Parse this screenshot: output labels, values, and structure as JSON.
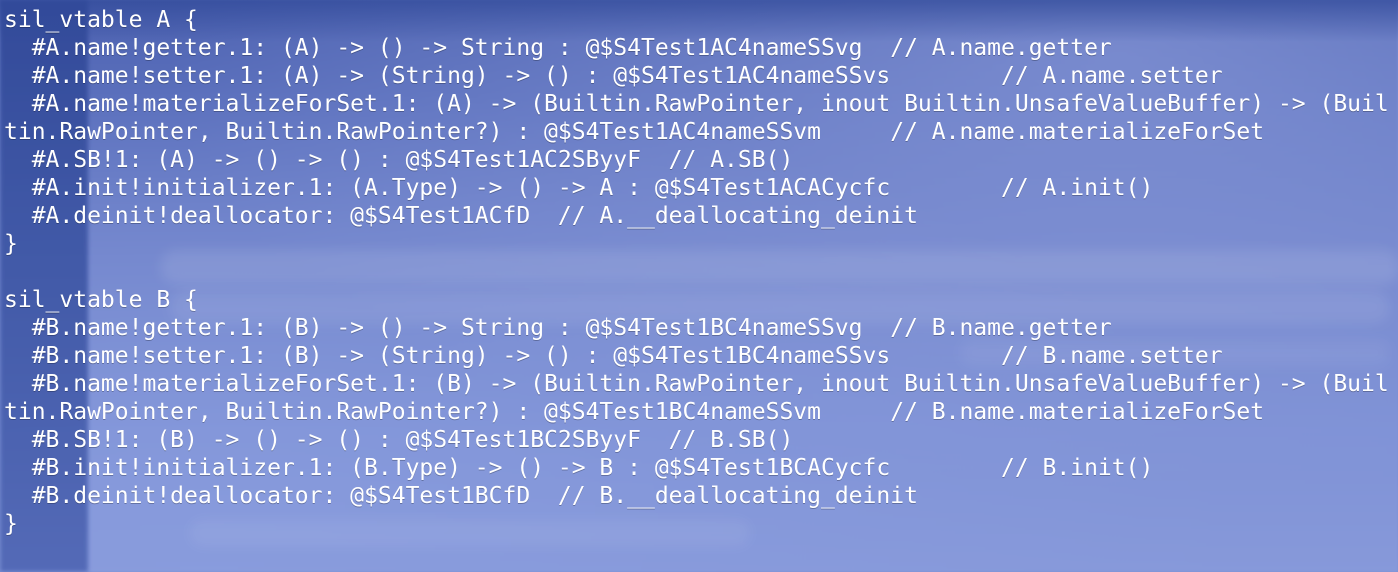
{
  "code": {
    "lines": [
      "sil_vtable A {",
      "  #A.name!getter.1: (A) -> () -> String : @$S4Test1AC4nameSSvg  // A.name.getter",
      "  #A.name!setter.1: (A) -> (String) -> () : @$S4Test1AC4nameSSvs        // A.name.setter",
      "  #A.name!materializeForSet.1: (A) -> (Builtin.RawPointer, inout Builtin.UnsafeValueBuffer) -> (Buil",
      "tin.RawPointer, Builtin.RawPointer?) : @$S4Test1AC4nameSSvm     // A.name.materializeForSet",
      "  #A.SB!1: (A) -> () -> () : @$S4Test1AC2SByyF  // A.SB()",
      "  #A.init!initializer.1: (A.Type) -> () -> A : @$S4Test1ACACycfc        // A.init()",
      "  #A.deinit!deallocator: @$S4Test1ACfD  // A.__deallocating_deinit",
      "}",
      "",
      "sil_vtable B {",
      "  #B.name!getter.1: (B) -> () -> String : @$S4Test1BC4nameSSvg  // B.name.getter",
      "  #B.name!setter.1: (B) -> (String) -> () : @$S4Test1BC4nameSSvs        // B.name.setter",
      "  #B.name!materializeForSet.1: (B) -> (Builtin.RawPointer, inout Builtin.UnsafeValueBuffer) -> (Buil",
      "tin.RawPointer, Builtin.RawPointer?) : @$S4Test1BC4nameSSvm     // B.name.materializeForSet",
      "  #B.SB!1: (B) -> () -> () : @$S4Test1BC2SByyF  // B.SB()",
      "  #B.init!initializer.1: (B.Type) -> () -> B : @$S4Test1BCACycfc        // B.init()",
      "  #B.deinit!deallocator: @$S4Test1BCfD  // B.__deallocating_deinit",
      "}"
    ]
  },
  "colors": {
    "text": "#ffffff",
    "background": "#7a8fd4",
    "background_dark": "#314a9a"
  }
}
